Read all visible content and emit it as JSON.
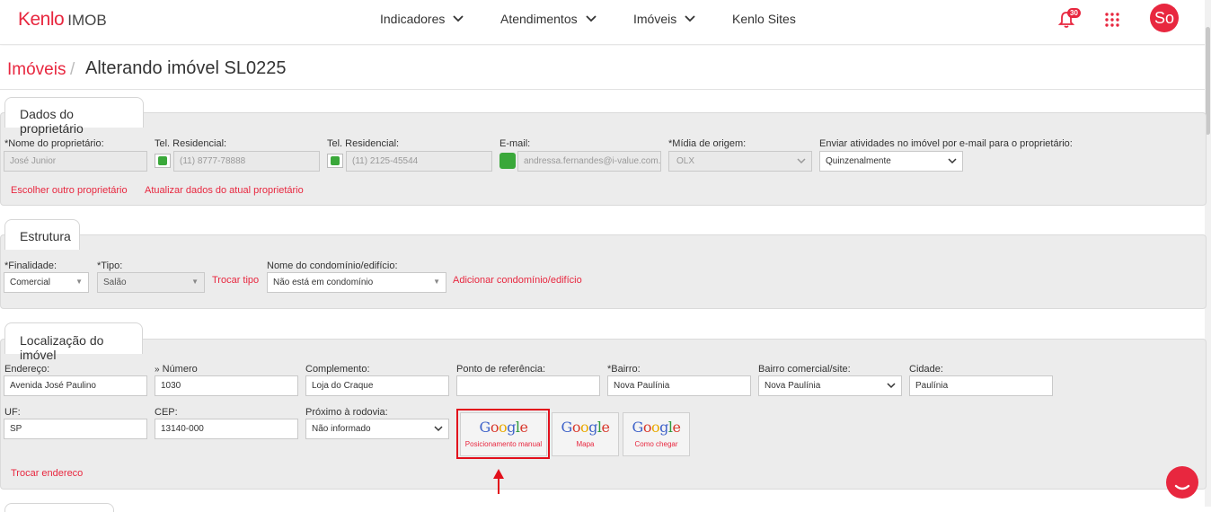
{
  "app": {
    "logo_main": "Kenlo",
    "logo_sub": "IMOB",
    "brand_color": "#e8273f",
    "nav": [
      {
        "label": "Indicadores"
      },
      {
        "label": "Atendimentos"
      },
      {
        "label": "Imóveis"
      },
      {
        "label": "Kenlo Sites"
      }
    ],
    "notification_count": "30",
    "avatar_initials": "So"
  },
  "breadcrumb": {
    "link": "Imóveis",
    "separator": "/",
    "title": "Alterando imóvel SL0225"
  },
  "owner": {
    "tab": "Dados do proprietário",
    "name_label": "*Nome do proprietário:",
    "name_value": "José Junior",
    "tel1_label": "Tel. Residencial:",
    "tel1_value": "(11) 8777-78888",
    "tel2_label": "Tel. Residencial:",
    "tel2_value": "(11) 2125-45544",
    "email_label": "E-mail:",
    "email_value": "andressa.fernandes@i-value.com.",
    "media_label": "*Mídia de origem:",
    "media_value": "OLX",
    "send_label": "Enviar atividades no imóvel por e-mail para o proprietário:",
    "send_value": "Quinzenalmente",
    "link_choose": "Escolher outro proprietário",
    "link_update": "Atualizar dados do atual proprietário"
  },
  "structure": {
    "tab": "Estrutura",
    "purpose_label": "*Finalidade:",
    "purpose_value": "Comercial",
    "type_label": "*Tipo:",
    "type_value": "Salão",
    "change_type": "Trocar tipo",
    "condo_label": "Nome do condomínio/edifício:",
    "condo_value": "Não está em condomínio",
    "add_condo": "Adicionar condomínio/edifício"
  },
  "location": {
    "tab": "Localização do imóvel",
    "address_label": "Endereço:",
    "address_value": "Avenida José Paulino",
    "number_label": "Número",
    "number_value": "1030",
    "complement_label": "Complemento:",
    "complement_value": "Loja do Craque",
    "reference_label": "Ponto de referência:",
    "reference_value": "",
    "neighborhood_label": "*Bairro:",
    "neighborhood_value": "Nova Paulínia",
    "commercial_label": "Bairro comercial/site:",
    "commercial_value": "Nova Paulínia",
    "city_label": "Cidade:",
    "city_value": "Paulínia",
    "uf_label": "UF:",
    "uf_value": "SP",
    "cep_label": "CEP:",
    "cep_value": "13140-000",
    "highway_label": "Próximo à rodovia:",
    "highway_value": "Não informado",
    "maps_word": "Google",
    "maps_small": "Maps",
    "maps_buttons": [
      {
        "caption": "Posicionamento manual"
      },
      {
        "caption": "Mapa"
      },
      {
        "caption": "Como chegar"
      }
    ],
    "change_address": "Trocar endereco"
  }
}
